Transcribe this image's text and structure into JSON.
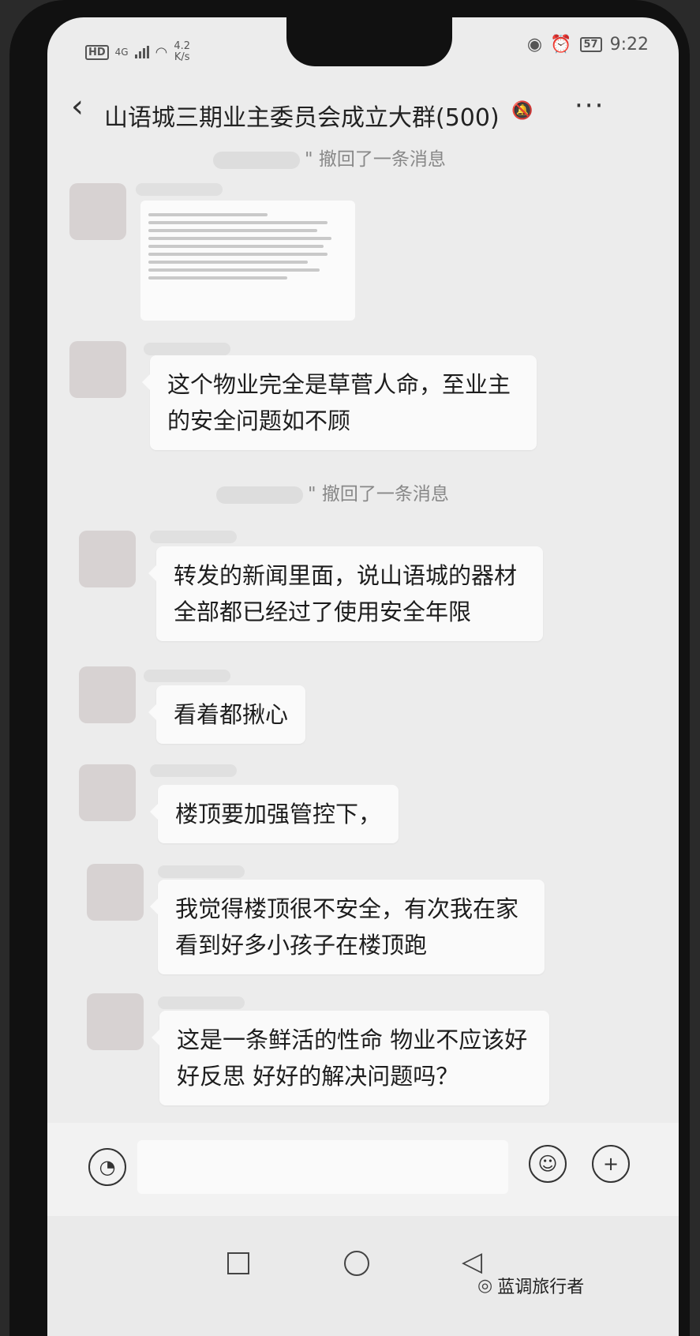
{
  "status": {
    "hd": "HD",
    "network": "4G",
    "speed_value": "4.2",
    "speed_unit": "K/s",
    "battery": "57",
    "time": "9:22"
  },
  "header": {
    "back_icon": "chevron-left-icon",
    "title": "山语城三期业主委员会成立大群(500)",
    "mute_icon": "bell-off-icon",
    "more_icon": "more-icon"
  },
  "messages": {
    "system_1": "\" 撤回了一条消息",
    "system_2": "\" 撤回了一条消息",
    "m1": "这个物业完全是草菅人命，至业主的安全问题如不顾",
    "m2": "转发的新闻里面，说山语城的器材全部都已经过了使用安全年限",
    "m3": "看着都揪心",
    "m4": "楼顶要加强管控下，",
    "m5": "我觉得楼顶很不安全，有次我在家看到好多小孩子在楼顶跑",
    "m6": "这是一条鲜活的性命  物业不应该好好反思  好好的解决问题吗？"
  },
  "watermark": "蓝调旅行者"
}
